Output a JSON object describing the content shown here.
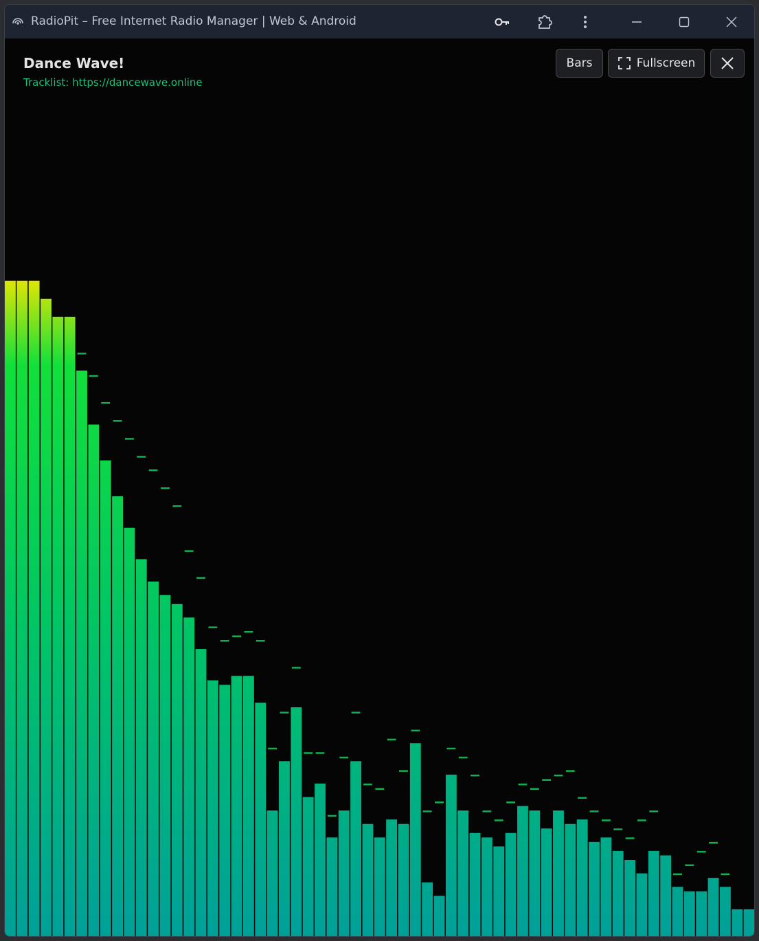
{
  "window": {
    "title": "RadioPit – Free Internet Radio Manager | Web & Android",
    "icons": [
      "radio-signal-icon",
      "key-icon",
      "extension-puzzle-icon",
      "more-vertical-icon",
      "minimize-icon",
      "maximize-icon",
      "close-icon"
    ]
  },
  "station": {
    "name": "Dance Wave!",
    "tracklist": "Tracklist: https://dancewave.online"
  },
  "controls": {
    "mode_label": "Bars",
    "fullscreen_label": "Fullscreen",
    "close_icon": "close-icon",
    "fullscreen_icon": "fullscreen-corners-icon"
  },
  "colors": {
    "bar_top_peak": "#f5e600",
    "bar_green": "#12e03a",
    "bar_base": "#00a099",
    "peak_marker": "#12b050",
    "accent_link": "#19c07a"
  },
  "visualizer": {
    "mode": "bars",
    "max_level": 1.0,
    "bar_levels": [
      0.73,
      0.73,
      0.73,
      0.71,
      0.69,
      0.69,
      0.63,
      0.57,
      0.53,
      0.49,
      0.455,
      0.42,
      0.395,
      0.38,
      0.37,
      0.355,
      0.32,
      0.285,
      0.28,
      0.29,
      0.29,
      0.26,
      0.14,
      0.195,
      0.255,
      0.155,
      0.17,
      0.11,
      0.14,
      0.195,
      0.125,
      0.11,
      0.13,
      0.125,
      0.215,
      0.06,
      0.045,
      0.18,
      0.14,
      0.115,
      0.11,
      0.1,
      0.115,
      0.145,
      0.14,
      0.12,
      0.14,
      0.125,
      0.13,
      0.105,
      0.11,
      0.095,
      0.085,
      0.07,
      0.095,
      0.09,
      0.055,
      0.05,
      0.05,
      0.065,
      0.055,
      0.03,
      0.03
    ],
    "peak_levels": [
      0.73,
      0.73,
      0.73,
      0.71,
      0.69,
      0.69,
      0.65,
      0.625,
      0.595,
      0.575,
      0.555,
      0.535,
      0.52,
      0.5,
      0.48,
      0.43,
      0.4,
      0.345,
      0.33,
      0.335,
      0.34,
      0.33,
      0.21,
      0.25,
      0.3,
      0.205,
      0.205,
      0.135,
      0.2,
      0.25,
      0.17,
      0.165,
      0.22,
      0.185,
      0.23,
      0.14,
      0.15,
      0.21,
      0.2,
      0.18,
      0.14,
      0.13,
      0.15,
      0.17,
      0.165,
      0.175,
      0.18,
      0.185,
      0.155,
      0.14,
      0.13,
      0.12,
      0.11,
      0.13,
      0.14,
      0.08,
      0.07,
      0.08,
      0.095,
      0.105,
      0.07,
      0.03,
      0.03
    ]
  }
}
